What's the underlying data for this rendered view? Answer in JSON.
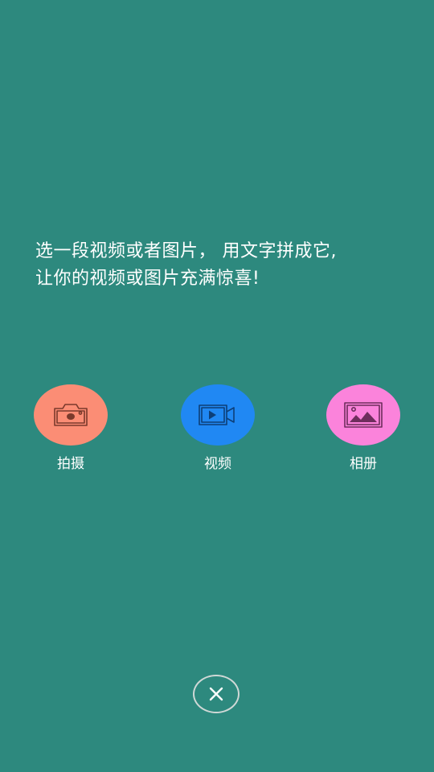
{
  "intro": {
    "line1": "选一段视频或者图片， 用文字拼成它,",
    "line2": "让你的视频或图片充满惊喜!"
  },
  "actions": [
    {
      "label": "拍摄",
      "icon": "camera-icon",
      "color": "#fb8d75",
      "icon_color": "#7a3a2c"
    },
    {
      "label": "视频",
      "icon": "video-camera-icon",
      "color": "#2088f3",
      "icon_color": "#0d3f78"
    },
    {
      "label": "相册",
      "icon": "picture-icon",
      "color": "#fb83db",
      "icon_color": "#6e2e5c"
    }
  ],
  "close": {
    "icon": "close-icon"
  },
  "colors": {
    "background": "#2d897e",
    "text": "#ffffff"
  }
}
